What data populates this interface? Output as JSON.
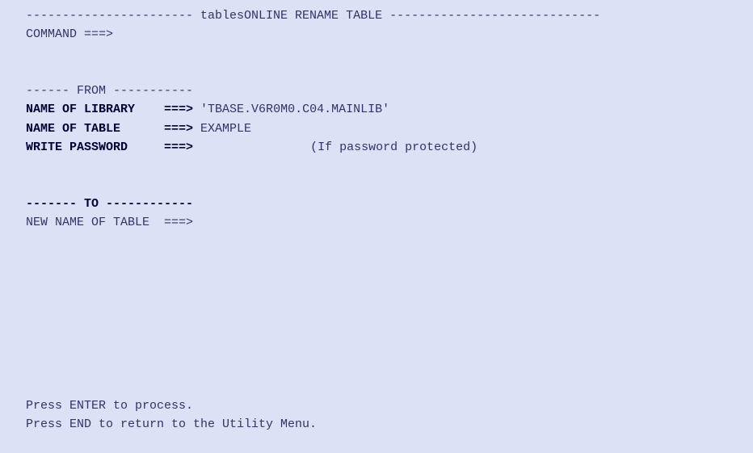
{
  "header": {
    "title_line": "----------------------- tablesONLINE RENAME TABLE -----------------------------"
  },
  "command": {
    "label": "COMMAND ===>",
    "value": ""
  },
  "from_section": {
    "divider": "------ FROM -----------",
    "library_label": "NAME OF LIBRARY    ===>",
    "library_value": " 'TBASE.V6R0M0.C04.MAINLIB'",
    "table_label": "NAME OF TABLE      ===>",
    "table_value": " EXAMPLE",
    "password_label": "WRITE PASSWORD     ===>",
    "password_value": "",
    "password_hint": "               (If password protected)"
  },
  "to_section": {
    "divider_left": "------- ",
    "divider_title": "TO",
    "divider_right": " ------------",
    "new_table_label": "NEW NAME OF TABLE  ===>",
    "new_table_value": ""
  },
  "footer": {
    "enter_hint": "Press ENTER to process.",
    "end_hint": "Press END to return to the Utility Menu."
  }
}
